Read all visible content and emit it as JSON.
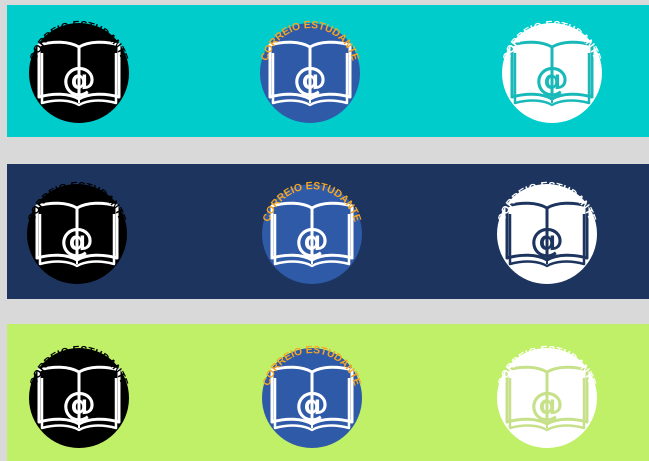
{
  "brand_text": "CORREIO ESTUDANTE",
  "icon_names": {
    "logo": "open-book-at-icon"
  },
  "rows": [
    {
      "background": "#00cccc",
      "logos": [
        {
          "circle": "#000000",
          "book_fill": "#000000",
          "book_stroke": "#ffffff",
          "at": "#ffffff",
          "text": "#000000"
        },
        {
          "circle": "#2f5aa8",
          "book_fill": "#2f5aa8",
          "book_stroke": "#ffffff",
          "at": "#ffffff",
          "text": "#f5a623"
        },
        {
          "circle": "#ffffff",
          "book_fill": "#ffffff",
          "book_stroke": "#19b9b9",
          "at": "#19b9b9",
          "text": "#ffffff"
        }
      ]
    },
    {
      "background": "#1c345e",
      "logos": [
        {
          "circle": "#000000",
          "book_fill": "#000000",
          "book_stroke": "#ffffff",
          "at": "#ffffff",
          "text": "#000000"
        },
        {
          "circle": "#2f5aa8",
          "book_fill": "#2f5aa8",
          "book_stroke": "#ffffff",
          "at": "#ffffff",
          "text": "#f5a623"
        },
        {
          "circle": "#ffffff",
          "book_fill": "#ffffff",
          "book_stroke": "#1c345e",
          "at": "#1c345e",
          "text": "#ffffff"
        }
      ]
    },
    {
      "background": "#c0ef68",
      "logos": [
        {
          "circle": "#000000",
          "book_fill": "#000000",
          "book_stroke": "#ffffff",
          "at": "#ffffff",
          "text": "#000000"
        },
        {
          "circle": "#2f5aa8",
          "book_fill": "#2f5aa8",
          "book_stroke": "#ffffff",
          "at": "#ffffff",
          "text": "#f5a623"
        },
        {
          "circle": "#ffffff",
          "book_fill": "#ffffff",
          "book_stroke": "#c7e08a",
          "at": "#c7e08a",
          "text": "#ffffff"
        }
      ]
    }
  ]
}
